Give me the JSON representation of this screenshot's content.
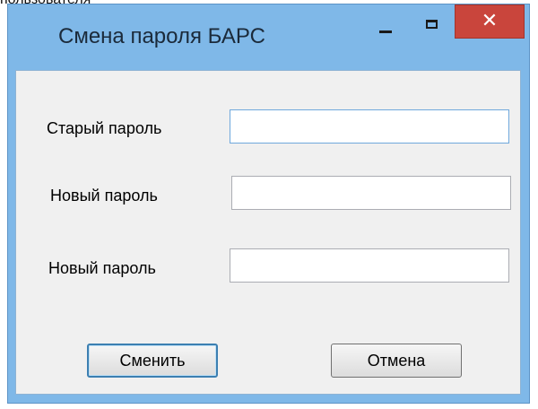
{
  "background": {
    "caption": "пользователя"
  },
  "window": {
    "title": "Смена пароля БАРС",
    "controls": {
      "close_glyph": "✕"
    }
  },
  "form": {
    "old_password_label": "Старый пароль",
    "old_password_value": "",
    "new_password_label": "Новый пароль",
    "new_password_value": "",
    "confirm_password_label": "Новый пароль",
    "confirm_password_value": ""
  },
  "buttons": {
    "change_label": "Сменить",
    "cancel_label": "Отмена"
  },
  "colors": {
    "titlebar": "#7fb8e8",
    "close_button": "#c9453c",
    "client_area": "#f0f0f0"
  }
}
